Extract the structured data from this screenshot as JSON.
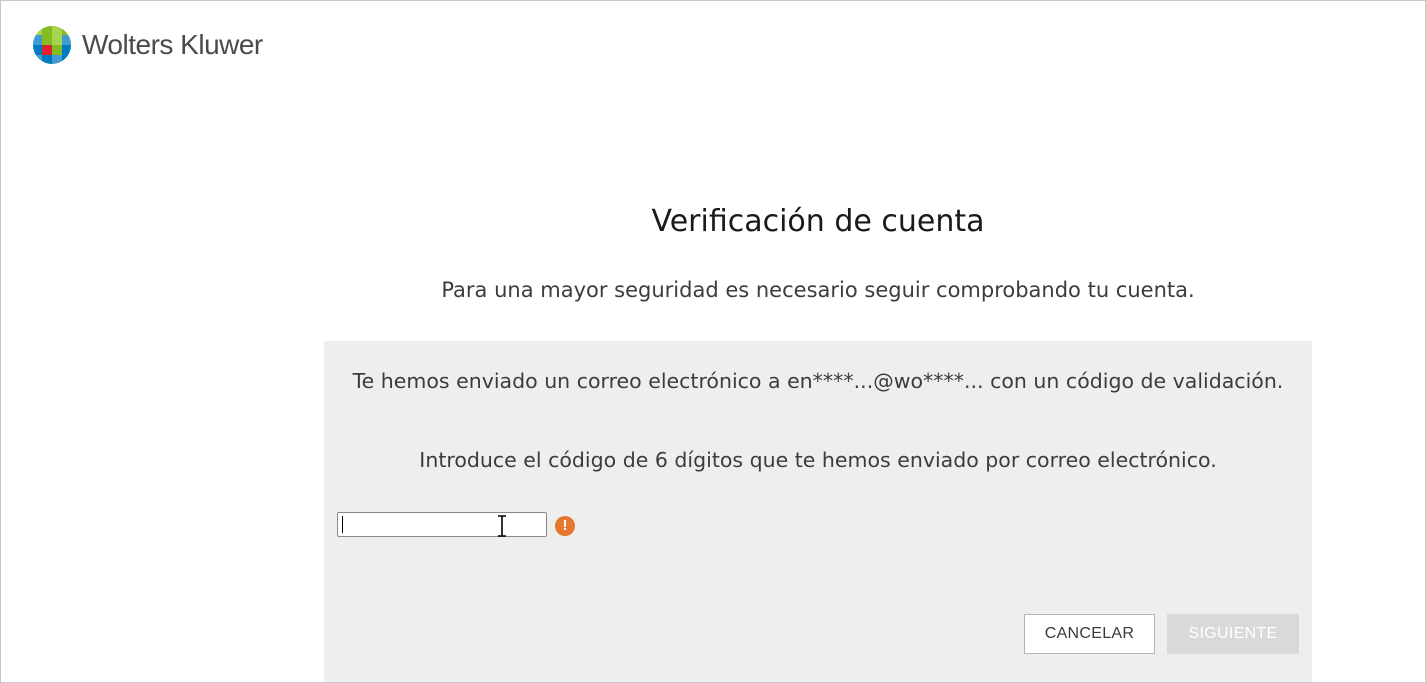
{
  "brand": {
    "name": "Wolters Kluwer",
    "logo_icon": "wolters-kluwer-globe-icon",
    "colors": [
      "#85bc22",
      "#007ac3",
      "#e5202e",
      "#409bd2",
      "#a6d44f"
    ]
  },
  "page": {
    "title": "Verificación de cuenta",
    "subtitle": "Para una mayor seguridad es necesario seguir comprobando tu cuenta."
  },
  "panel": {
    "message_sent": "Te hemos enviado un correo electrónico a en****...@wo****... con un código de validación.",
    "instruction": "Introduce el código de 6 dígitos que te hemos enviado por correo electrónico.",
    "code_value": "",
    "warning_icon": "exclamation-circle-icon",
    "warning_color": "#e5772e"
  },
  "actions": {
    "cancel_label": "CANCELAR",
    "next_label": "SIGUIENTE"
  }
}
